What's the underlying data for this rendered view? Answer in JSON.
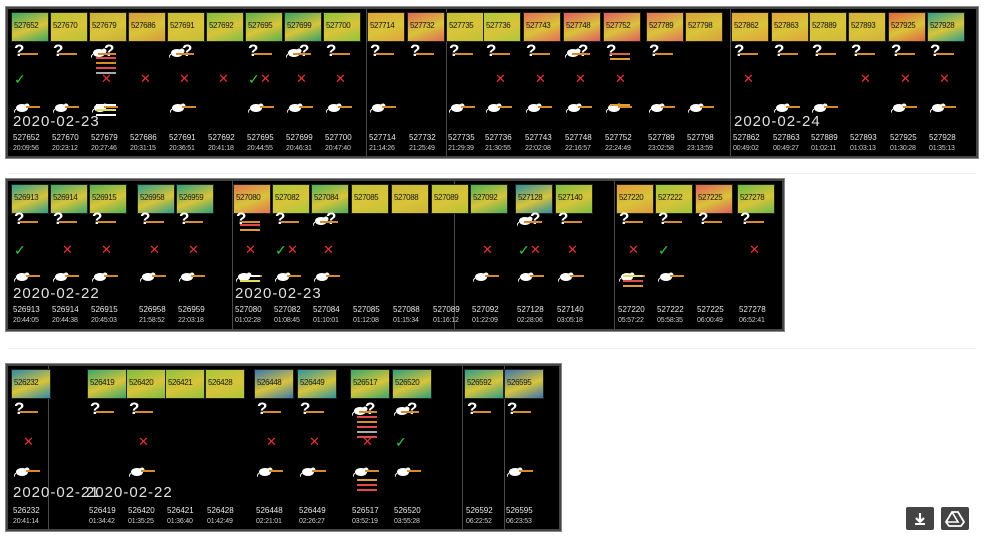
{
  "panels": [
    {
      "date_labels": [
        "2020-02-23",
        "2020-02-24"
      ],
      "items": [
        {
          "id": "527652",
          "time": "20:09:56",
          "heat": "#3aa860"
        },
        {
          "id": "527670",
          "time": "20:23:12",
          "heat": "#b9c234"
        },
        {
          "id": "527679",
          "time": "20:27:46",
          "heat": "#c7b038"
        },
        {
          "id": "527686",
          "time": "20:31:15",
          "heat": "#d59a3a"
        },
        {
          "id": "527691",
          "time": "20:36:51",
          "heat": "#c3be35"
        },
        {
          "id": "527692",
          "time": "20:41:18",
          "heat": "#7fbf42"
        },
        {
          "id": "527695",
          "time": "20:44:55",
          "heat": "#5bb14a"
        },
        {
          "id": "527699",
          "time": "20:46:31",
          "heat": "#33a365"
        },
        {
          "id": "527700",
          "time": "20:47:40",
          "heat": "#8fc43c"
        },
        {
          "id": "527714",
          "time": "21:14:26",
          "heat": "#e1a339"
        },
        {
          "id": "527732",
          "time": "21:25:49",
          "heat": "#e06a55"
        },
        {
          "id": "527735",
          "time": "21:29:39",
          "heat": "#bfc236"
        },
        {
          "id": "527736",
          "time": "21:30:55",
          "heat": "#aec93a"
        },
        {
          "id": "527743",
          "time": "22:02:08",
          "heat": "#e66b56"
        },
        {
          "id": "527748",
          "time": "22:16:57",
          "heat": "#e05a62"
        },
        {
          "id": "527752",
          "time": "22:24:49",
          "heat": "#e25c60"
        },
        {
          "id": "527789",
          "time": "23:02:58",
          "heat": "#e2725a"
        },
        {
          "id": "527798",
          "time": "23:13:59",
          "heat": "#d8a13a"
        },
        {
          "id": "527862",
          "time": "00:49:02",
          "heat": "#e2a23a"
        },
        {
          "id": "527863",
          "time": "00:49:27",
          "heat": "#e2a23a"
        },
        {
          "id": "527889",
          "time": "01:02:11",
          "heat": "#cdb938"
        },
        {
          "id": "527893",
          "time": "01:03:13",
          "heat": "#d2b03a"
        },
        {
          "id": "527925",
          "time": "01:30:28",
          "heat": "#e0653f"
        },
        {
          "id": "527928",
          "time": "01:35:13",
          "heat": "#2ea08a"
        }
      ]
    },
    {
      "date_labels": [
        "2020-02-22",
        "2020-02-23"
      ],
      "items": [
        {
          "id": "526913",
          "time": "20:44:05",
          "heat": "#2e9e88"
        },
        {
          "id": "526914",
          "time": "20:44:38",
          "heat": "#3ba96d"
        },
        {
          "id": "526915",
          "time": "20:45:03",
          "heat": "#55b150"
        },
        {
          "id": "526958",
          "time": "21:58:52",
          "heat": "#2e9e88"
        },
        {
          "id": "526959",
          "time": "22:03:18",
          "heat": "#2ea07a"
        },
        {
          "id": "527080",
          "time": "01:02:28",
          "heat": "#e27552"
        },
        {
          "id": "527082",
          "time": "01:08:45",
          "heat": "#aac83a"
        },
        {
          "id": "527084",
          "time": "01:10:01",
          "heat": "#4fb05a"
        },
        {
          "id": "527085",
          "time": "01:12:08",
          "heat": "#c0c236"
        },
        {
          "id": "527088",
          "time": "01:15:34",
          "heat": "#c9b637"
        },
        {
          "id": "527089",
          "time": "01:16:12",
          "heat": "#b9c134"
        },
        {
          "id": "527092",
          "time": "01:22:09",
          "heat": "#4caf55"
        },
        {
          "id": "527128",
          "time": "02:28:06",
          "heat": "#2d8ea0"
        },
        {
          "id": "527140",
          "time": "03:05:18",
          "heat": "#7abf42"
        },
        {
          "id": "527220",
          "time": "05:57:22",
          "heat": "#e09a3a"
        },
        {
          "id": "527222",
          "time": "05:58:35",
          "heat": "#9ec63a"
        },
        {
          "id": "527225",
          "time": "06:00:49",
          "heat": "#e06058"
        },
        {
          "id": "527278",
          "time": "06:52:41",
          "heat": "#6bba48"
        }
      ]
    },
    {
      "date_labels": [
        "2020-02-21",
        "2020-02-22"
      ],
      "items": [
        {
          "id": "526232",
          "time": "20:41:14",
          "heat": "#2e8aa8"
        },
        {
          "id": "526419",
          "time": "01:34:42",
          "heat": "#3aa86a"
        },
        {
          "id": "526420",
          "time": "01:35:25",
          "heat": "#7abf42"
        },
        {
          "id": "526421",
          "time": "01:36:40",
          "heat": "#8fc43c"
        },
        {
          "id": "526428",
          "time": "01:42:49",
          "heat": "#a8c83a"
        },
        {
          "id": "526448",
          "time": "02:21:01",
          "heat": "#3a78b0"
        },
        {
          "id": "526449",
          "time": "02:26:27",
          "heat": "#2e94a0"
        },
        {
          "id": "526517",
          "time": "03:52:19",
          "heat": "#3aa86a"
        },
        {
          "id": "526520",
          "time": "03:55:28",
          "heat": "#2ea07a"
        },
        {
          "id": "526592",
          "time": "06:22:52",
          "heat": "#2e9e88"
        },
        {
          "id": "526595",
          "time": "06:23:53",
          "heat": "#3a74b0"
        }
      ]
    }
  ],
  "actions": [
    {
      "label": "download",
      "icon": "download-icon"
    },
    {
      "label": "drive",
      "icon": "drive-icon"
    }
  ],
  "colors": {
    "check": "#39c639",
    "cross": "#e53232",
    "bar": "#d98a2a"
  }
}
